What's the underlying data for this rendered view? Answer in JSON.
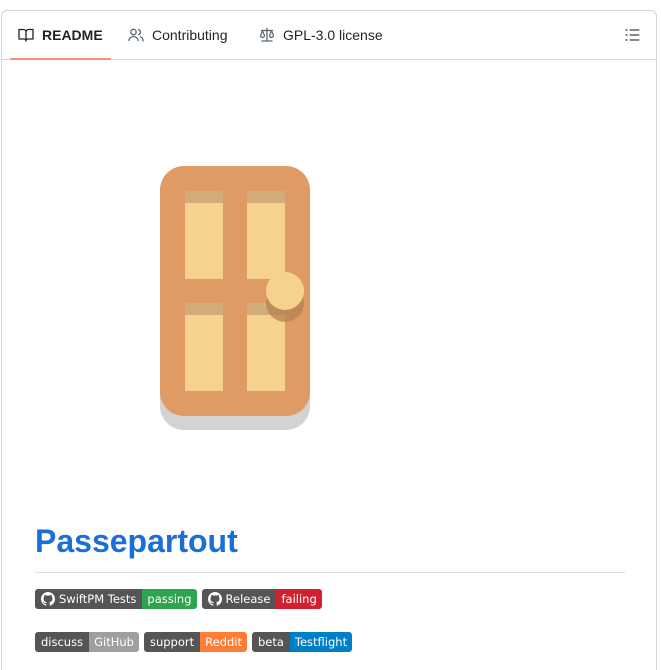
{
  "tabs": [
    {
      "label": "README",
      "icon": "book-icon",
      "active": true
    },
    {
      "label": "Contributing",
      "icon": "people-icon",
      "active": false
    },
    {
      "label": "GPL-3.0 license",
      "icon": "law-scale-icon",
      "active": false
    }
  ],
  "outline_icon": "list-unordered-icon",
  "readme": {
    "title": "Passepartout"
  },
  "badges_row1": [
    {
      "left": "SwiftPM Tests",
      "right": "passing",
      "right_color": "#2ea44f",
      "has_github_icon": true
    },
    {
      "left": "Release",
      "right": "failing",
      "right_color": "#cf222e",
      "has_github_icon": true
    }
  ],
  "badges_row2": [
    {
      "left": "discuss",
      "right": "GitHub",
      "right_color": "#9f9f9f"
    },
    {
      "left": "support",
      "right": "Reddit",
      "right_color": "#fe7d37"
    },
    {
      "left": "beta",
      "right": "Testflight",
      "right_color": "#007ec6"
    }
  ],
  "colors": {
    "link": "#1a6fd8",
    "tab_underline": "#fd8c73",
    "door": "#e09a63",
    "door_panel": "#f6d28f"
  }
}
